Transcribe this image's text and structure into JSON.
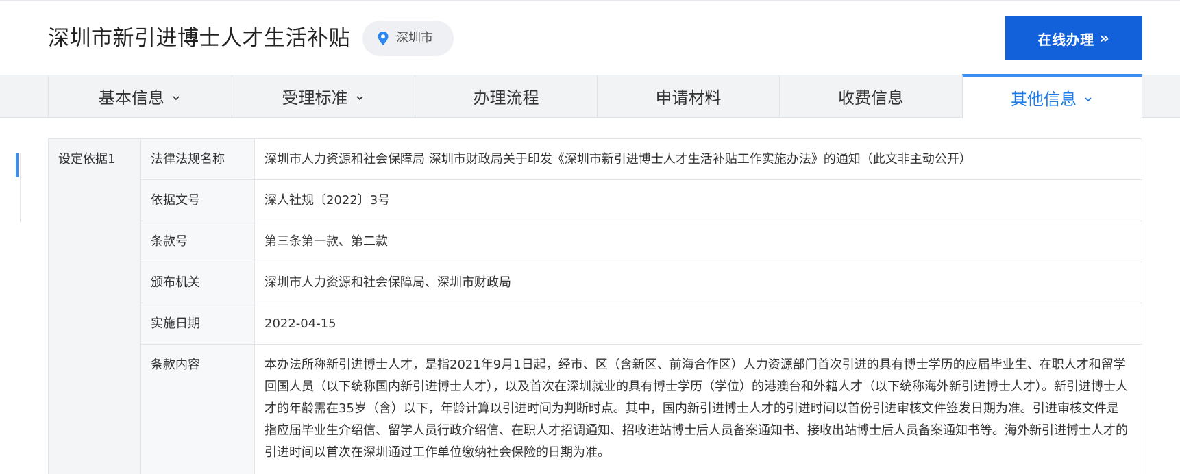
{
  "header": {
    "title": "深圳市新引进博士人才生活补贴",
    "location": "深圳市",
    "apply_button": "在线办理",
    "apply_chevron": "»"
  },
  "tabs": [
    {
      "label": "基本信息",
      "has_dropdown": true,
      "active": false
    },
    {
      "label": "受理标准",
      "has_dropdown": true,
      "active": false
    },
    {
      "label": "办理流程",
      "has_dropdown": false,
      "active": false
    },
    {
      "label": "申请材料",
      "has_dropdown": false,
      "active": false
    },
    {
      "label": "收费信息",
      "has_dropdown": false,
      "active": false
    },
    {
      "label": "其他信息",
      "has_dropdown": true,
      "active": true
    }
  ],
  "basis": {
    "group_label": "设定依据1",
    "rows": [
      {
        "label": "法律法规名称",
        "value": "深圳市人力资源和社会保障局 深圳市财政局关于印发《深圳市新引进博士人才生活补贴工作实施办法》的通知（此文非主动公开）"
      },
      {
        "label": "依据文号",
        "value": "深人社规〔2022〕3号"
      },
      {
        "label": "条款号",
        "value": "第三条第一款、第二款"
      },
      {
        "label": "颁布机关",
        "value": "深圳市人力资源和社会保障局、深圳市财政局"
      },
      {
        "label": "实施日期",
        "value": "2022-04-15"
      },
      {
        "label": "条款内容",
        "value": "本办法所称新引进博士人才，是指2021年9月1日起，经市、区（含新区、前海合作区）人力资源部门首次引进的具有博士学历的应届毕业生、在职人才和留学回国人员（以下统称国内新引进博士人才），以及首次在深圳就业的具有博士学历（学位）的港澳台和外籍人才（以下统称海外新引进博士人才）。新引进博士人才的年龄需在35岁（含）以下，年龄计算以引进时间为判断时点。其中，国内新引进博士人才的引进时间以首份引进审核文件签发日期为准。引进审核文件是指应届毕业生介绍信、留学人员行政介绍信、在职人才招调通知、招收进站博士后人员备案通知书、接收出站博士后人员备案通知书等。海外新引进博士人才的引进时间以首次在深圳通过工作单位缴纳社会保险的日期为准。"
      }
    ]
  },
  "colors": {
    "accent": "#1261db",
    "active_tab_text": "#1e7be6",
    "tab_bar": "#f2f3f5",
    "border": "#e1e4e8"
  },
  "icons": {
    "location": "map-pin-icon",
    "dropdown": "chevron-down-icon"
  }
}
